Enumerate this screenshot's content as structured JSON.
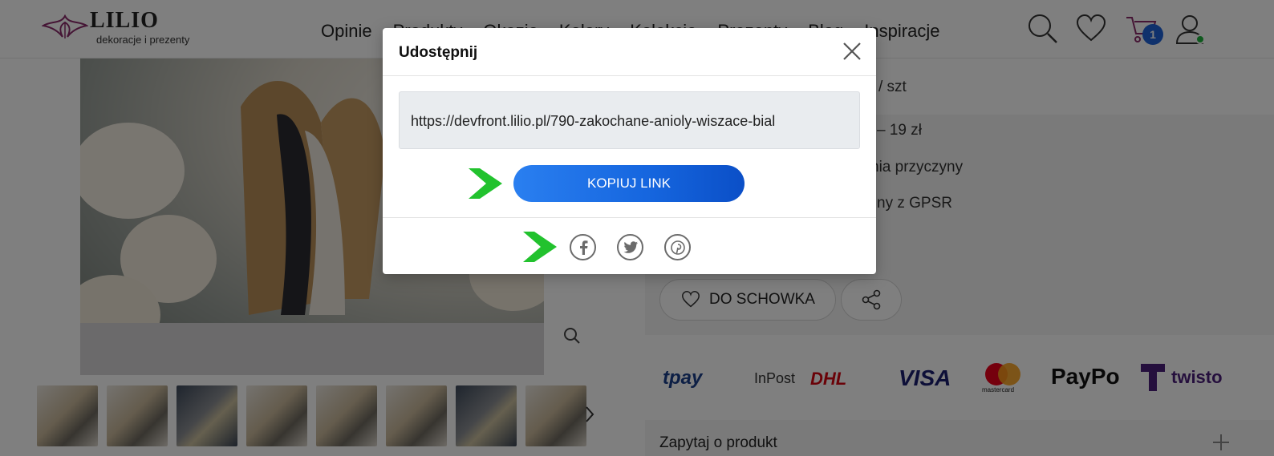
{
  "header": {
    "logo_name": "LILIO",
    "logo_tagline": "dekoracje i prezenty",
    "nav": [
      "Opinie",
      "Produkty",
      "Okazje",
      "Kolory",
      "Kolekcje",
      "Prezenty",
      "Blog",
      "Inspiracje"
    ],
    "cart_count": "1",
    "icons": [
      "search-icon",
      "heart-icon",
      "cart-icon",
      "user-icon"
    ]
  },
  "product": {
    "price_unit": "/ szt",
    "shipping_price": "– 19 zł",
    "return_note": "nia przyczyny",
    "gpsr_note": "ny z GPSR",
    "wishlist_label": "DO SCHOWKA",
    "thumbnail_count": 8,
    "payment_logos": [
      "tpay",
      "InPost",
      "DHL",
      "VISA",
      "mastercard",
      "PayPo",
      "twisto"
    ],
    "ask_label": "Zapytaj o produkt"
  },
  "modal": {
    "title": "Udostępnij",
    "link_value": "https://devfront.lilio.pl/790-zakochane-anioly-wiszace-bial",
    "copy_button_label": "KOPIUJ LINK",
    "social": [
      "facebook-icon",
      "twitter-icon",
      "pinterest-icon"
    ]
  },
  "colors": {
    "accent_blue": "#1565de",
    "badge_blue": "#1e63d8",
    "online_green": "#1fb33d",
    "arrow_green": "#22c22e",
    "logo_purple": "#8a2a6a",
    "overlay": "rgba(0,0,0,0.5)"
  }
}
